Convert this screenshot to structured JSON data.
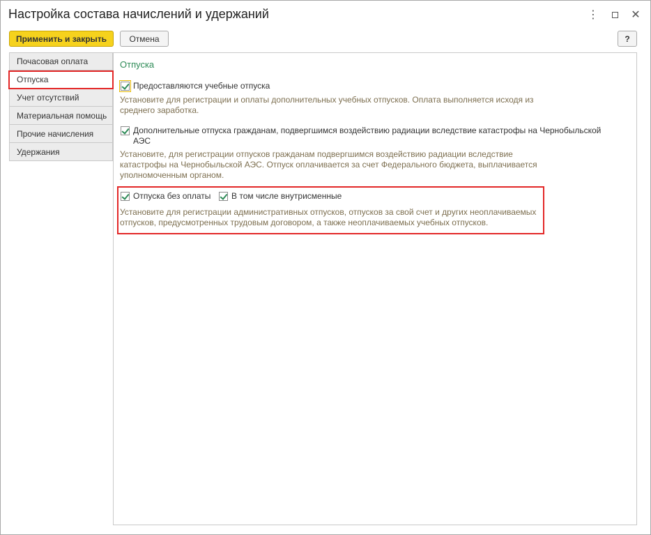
{
  "window": {
    "title": "Настройка состава начислений и удержаний",
    "more_glyph": "⋮",
    "close_glyph": "✕"
  },
  "toolbar": {
    "apply_label": "Применить и закрыть",
    "cancel_label": "Отмена",
    "help_label": "?"
  },
  "sidebar": {
    "items": [
      {
        "label": "Почасовая оплата"
      },
      {
        "label": "Отпуска"
      },
      {
        "label": "Учет отсутствий"
      },
      {
        "label": "Материальная помощь"
      },
      {
        "label": "Прочие начисления"
      },
      {
        "label": "Удержания"
      }
    ],
    "active_index": 1
  },
  "main": {
    "section_title": "Отпуска",
    "options": [
      {
        "label": "Предоставляются учебные отпуска",
        "checked": true,
        "hint_line1": "Установите для регистрации и оплаты дополнительных учебных отпусков. Оплата выполняется исходя из",
        "hint_line2": "среднего заработка."
      },
      {
        "label_line1": "Дополнительные отпуска гражданам, подвергшимся воздействию радиации вследствие катастрофы на Чернобыльской",
        "label_line2": "АЭС",
        "checked": true,
        "hint_line1": "Установите, для регистрации отпусков гражданам подвергшимся воздействию радиации вследствие",
        "hint_line2": "катастрофы на Чернобыльской АЭС. Отпуск оплачивается за счет Федерального бюджета, выплачивается",
        "hint_line3": "уполномоченным органом."
      },
      {
        "label": "Отпуска без оплаты",
        "checked": true,
        "sub_label": "В том числе внутрисменные",
        "sub_checked": true,
        "hint_line1": "Установите для регистрации административных отпусков, отпусков за свой счет и других неоплачиваемых",
        "hint_line2": "отпусков, предусмотренных трудовым договором, а также неоплачиваемых учебных отпусков."
      }
    ]
  },
  "colors": {
    "accent_green": "#2e8b57",
    "hint_text": "#7d6f50",
    "apply_button": "#f6d21d",
    "highlight_red": "#e32626"
  }
}
